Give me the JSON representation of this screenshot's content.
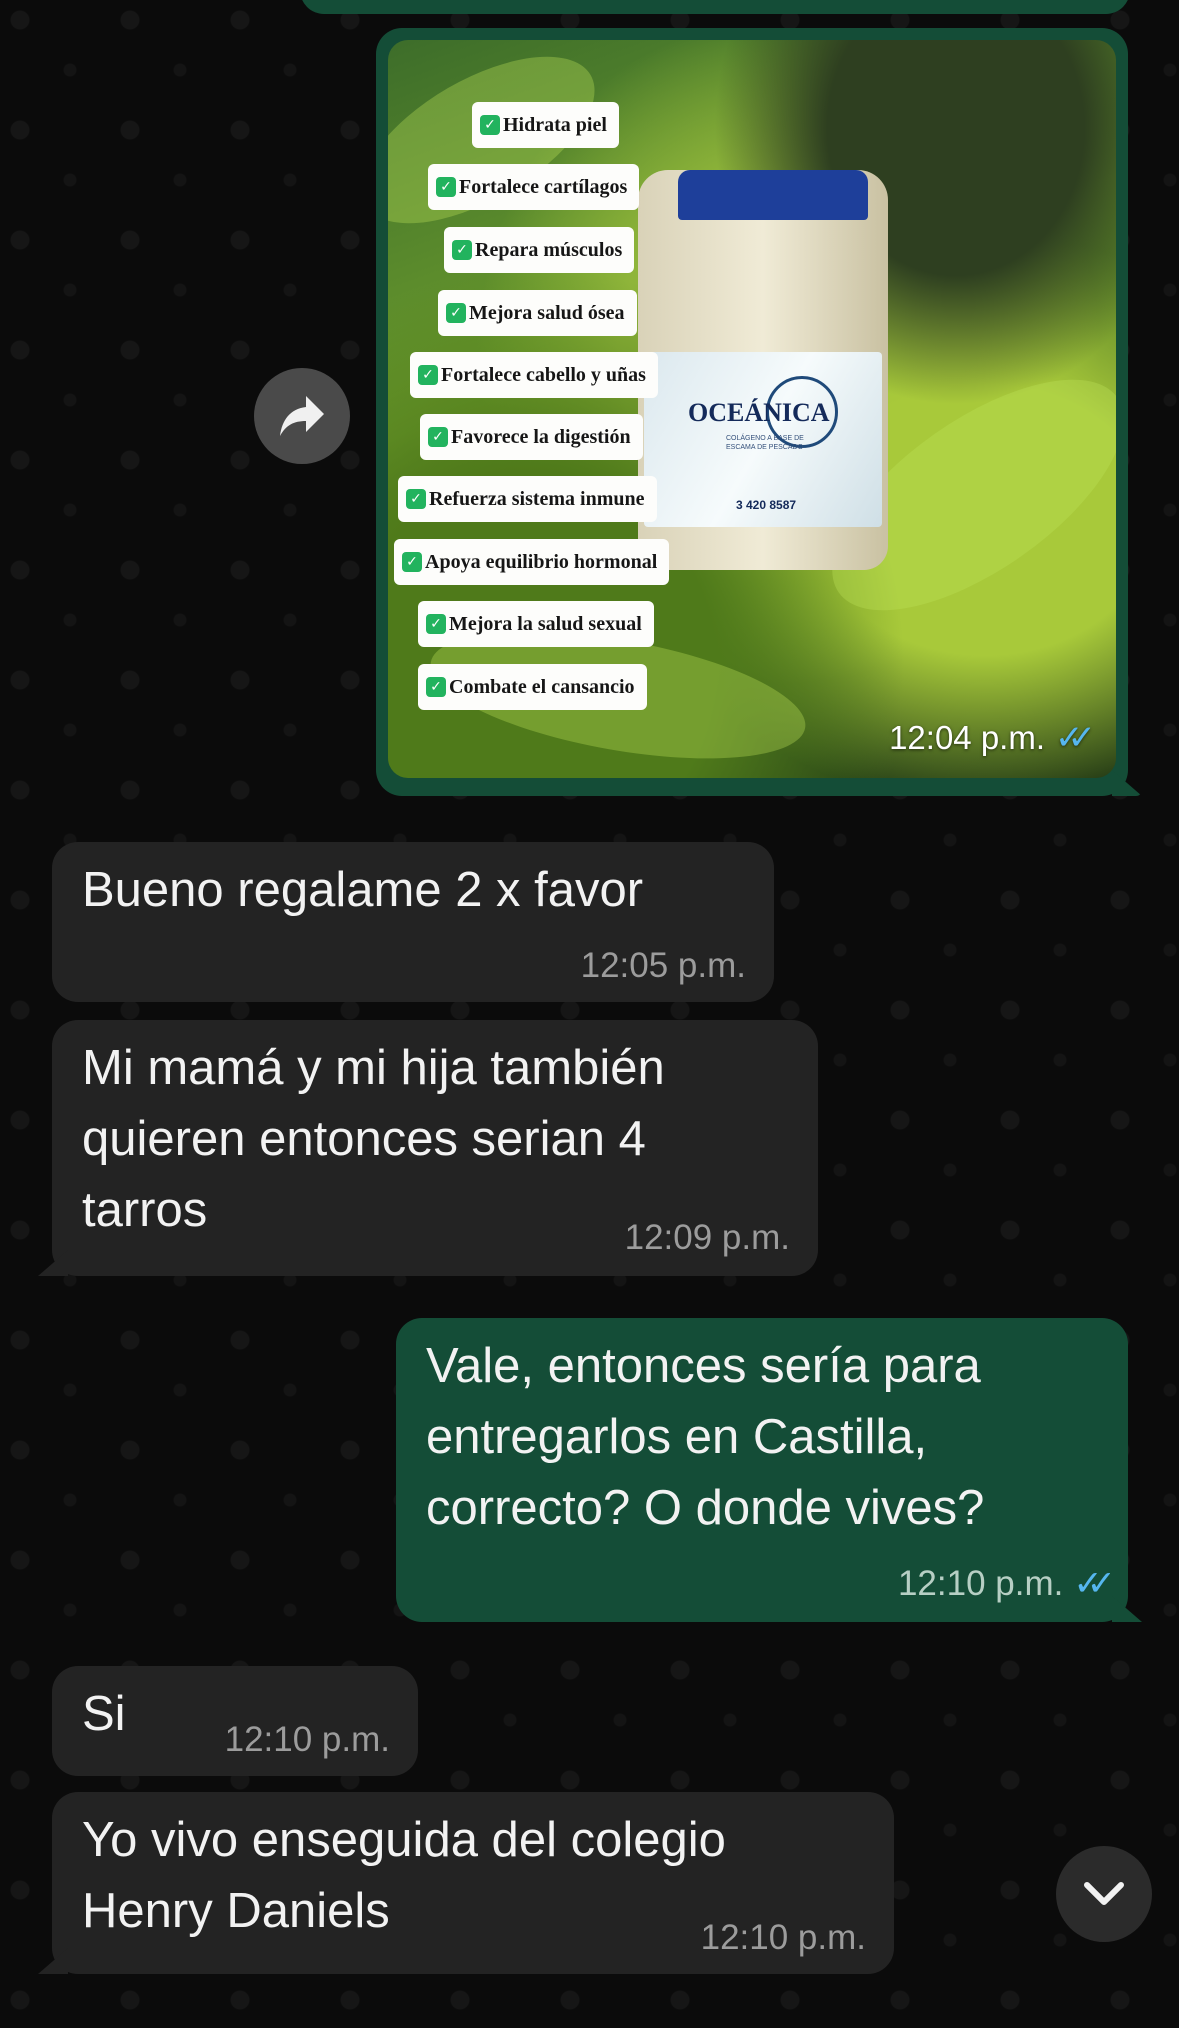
{
  "image_message": {
    "benefits": [
      "Hidrata piel",
      "Fortalece cartílagos",
      "Repara músculos",
      "Mejora salud ósea",
      "Fortalece cabello y uñas",
      "Favorece la digestión",
      "Refuerza sistema inmune",
      "Apoya equilibrio hormonal",
      "Mejora la salud sexual",
      "Combate el cansancio"
    ],
    "product_brand": "OCEÁNICA",
    "product_subtitle": "COLÁGENO A BASE DE ESCAMA DE PESCADO",
    "product_phone": "3 420 8587",
    "time": "12:04 p.m.",
    "status_icon": "double-check-read-icon"
  },
  "messages": [
    {
      "direction": "incoming",
      "text": "Bueno regalame 2 x favor",
      "time": "12:05 p.m."
    },
    {
      "direction": "incoming",
      "text": "Mi mamá y mi hija también\nquieren entonces serian 4\ntarros",
      "time": "12:09 p.m."
    },
    {
      "direction": "outgoing",
      "text": "Vale, entonces sería para\nentregarlos en Castilla,\ncorrecto? O donde vives?",
      "time": "12:10 p.m."
    },
    {
      "direction": "incoming",
      "text": "Si",
      "time": "12:10 p.m."
    },
    {
      "direction": "incoming",
      "text": "Yo vivo enseguida del colegio\nHenry Daniels",
      "time": "12:10 p.m."
    }
  ],
  "icons": {
    "forward": "forward-arrow-icon",
    "scroll": "chevron-down-icon",
    "read": "double-check-read-icon"
  },
  "colors": {
    "outgoing_bubble": "#144d37",
    "incoming_bubble": "#232323",
    "read_ticks": "#56b6ef",
    "background": "#0b0b0b"
  }
}
